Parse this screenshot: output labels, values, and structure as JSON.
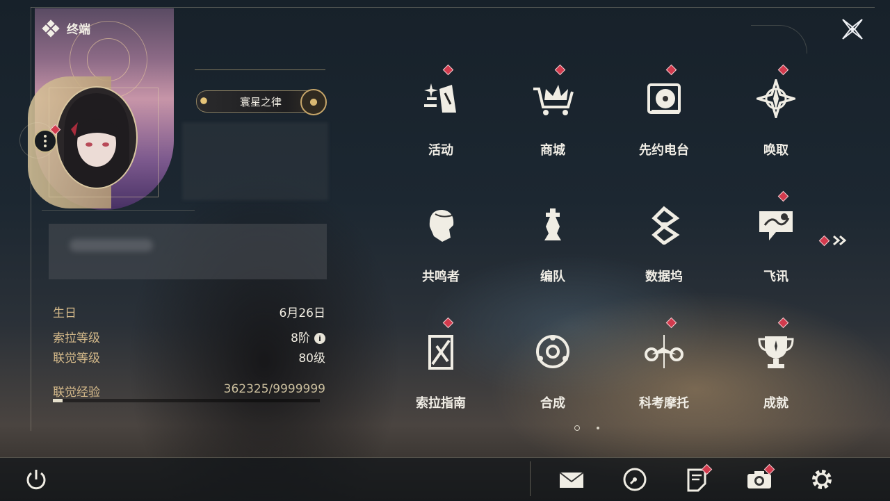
{
  "header": {
    "title": "终端"
  },
  "profile": {
    "badge_title": "寰星之律",
    "stats": [
      {
        "label": "生日",
        "value": "6月26日"
      },
      {
        "label": "索拉等级",
        "value": "8阶"
      },
      {
        "label": "联觉等级",
        "value": "80级"
      },
      {
        "label": "联觉经验",
        "value": "362325/9999999"
      }
    ],
    "xp_progress_fraction": 0.036
  },
  "grid": {
    "items": [
      {
        "label": "活动",
        "icon": "sparkle-flag-icon",
        "badge": true
      },
      {
        "label": "商城",
        "icon": "shopping-cart-crown-icon",
        "badge": true
      },
      {
        "label": "先约电台",
        "icon": "radio-vinyl-icon",
        "badge": true
      },
      {
        "label": "唤取",
        "icon": "compass-star-icon",
        "badge": true
      },
      {
        "label": "共鸣者",
        "icon": "character-head-icon",
        "badge": false
      },
      {
        "label": "编队",
        "icon": "chess-king-icon",
        "badge": false
      },
      {
        "label": "数据坞",
        "icon": "data-crystal-icon",
        "badge": false
      },
      {
        "label": "飞讯",
        "icon": "chat-bubble-icon",
        "badge": true
      },
      {
        "label": "索拉指南",
        "icon": "guide-book-icon",
        "badge": true
      },
      {
        "label": "合成",
        "icon": "synthesis-orb-icon",
        "badge": false
      },
      {
        "label": "科考摩托",
        "icon": "motorcycle-icon",
        "badge": true
      },
      {
        "label": "成就",
        "icon": "trophy-icon",
        "badge": true
      }
    ],
    "pagination": {
      "current": 1,
      "total": 2
    }
  },
  "bottom_bar": {
    "icons": [
      "power-icon",
      "mail-icon",
      "clock-icon",
      "notice-icon",
      "camera-icon",
      "settings-gear-icon"
    ]
  },
  "colors": {
    "accent_gold": "#d4b98a",
    "badge_red": "#d23a4d"
  }
}
